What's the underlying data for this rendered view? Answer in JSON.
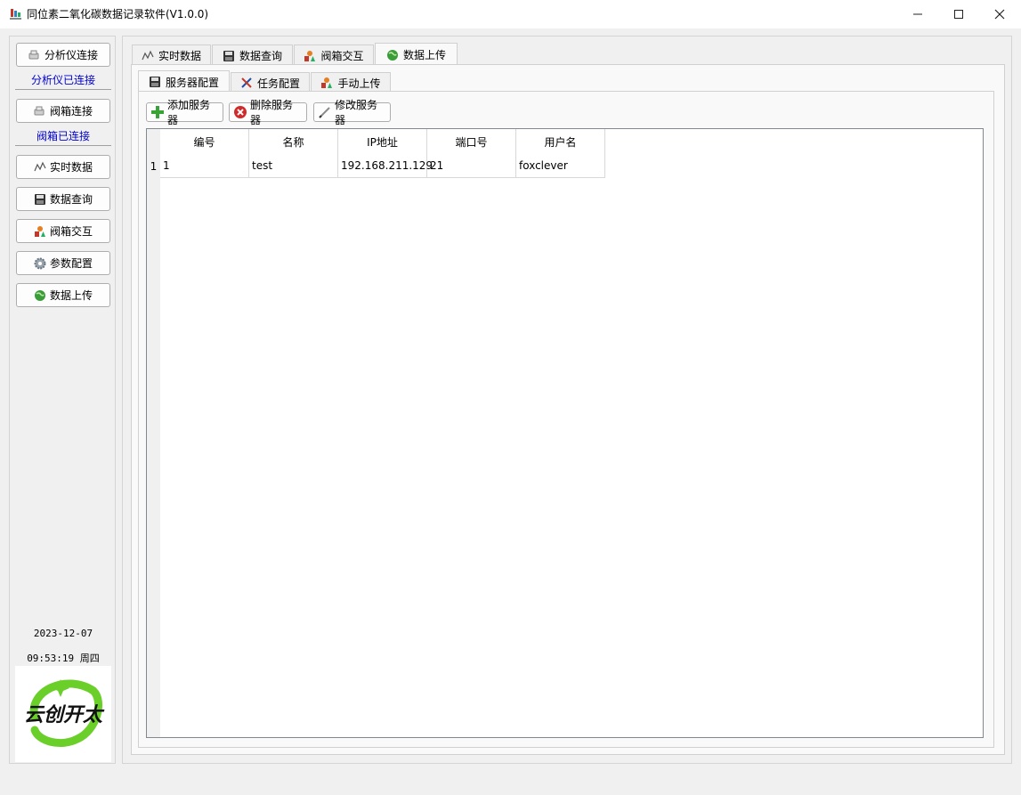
{
  "window": {
    "title": "同位素二氧化碳数据记录软件(V1.0.0)",
    "minimize": "—",
    "maximize": "☐",
    "close": "✕"
  },
  "sidebar": {
    "analyzer_connect": "分析仪连接",
    "analyzer_status": "分析仪已连接",
    "valvebox_connect": "阀箱连接",
    "valvebox_status": "阀箱已连接",
    "items": [
      {
        "label": "实时数据",
        "icon": "line-chart-icon"
      },
      {
        "label": "数据查询",
        "icon": "floppy-disk-icon"
      },
      {
        "label": "阀箱交互",
        "icon": "colored-shapes-icon"
      },
      {
        "label": "参数配置",
        "icon": "gear-icon"
      },
      {
        "label": "数据上传",
        "icon": "globe-icon"
      }
    ],
    "date": "2023-12-07",
    "time": "09:53:19 周四",
    "logo_text": "云创开太"
  },
  "main_tabs": [
    {
      "label": "实时数据",
      "icon": "line-chart-icon",
      "active": false
    },
    {
      "label": "数据查询",
      "icon": "floppy-disk-icon",
      "active": false
    },
    {
      "label": "阀箱交互",
      "icon": "colored-shapes-icon",
      "active": false
    },
    {
      "label": "数据上传",
      "icon": "globe-icon",
      "active": true
    }
  ],
  "sub_tabs": [
    {
      "label": "服务器配置",
      "icon": "floppy-disk-icon",
      "active": true
    },
    {
      "label": "任务配置",
      "icon": "tools-icon",
      "active": false
    },
    {
      "label": "手动上传",
      "icon": "colored-shapes-icon",
      "active": false
    }
  ],
  "toolbar": {
    "add": "添加服务器",
    "delete": "删除服务器",
    "edit": "修改服务器"
  },
  "table": {
    "columns": [
      "编号",
      "名称",
      "IP地址",
      "端口号",
      "用户名"
    ],
    "rows": [
      {
        "row_number": "1",
        "cells": [
          "1",
          "test",
          "192.168.211.129",
          "21",
          "foxclever"
        ]
      }
    ]
  },
  "colors": {
    "status_text": "#0000cc",
    "logo_green": "#6bcf2a",
    "window_bg": "#f0f0f0"
  }
}
